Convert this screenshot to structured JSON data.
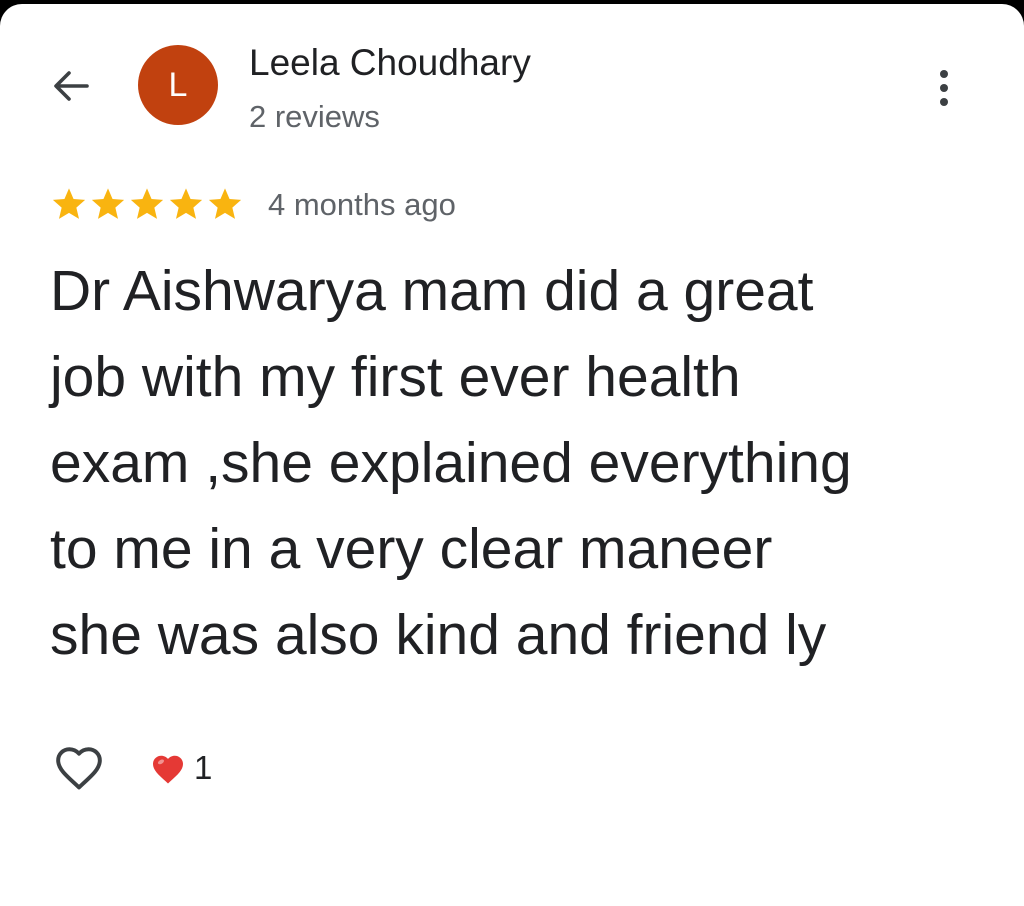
{
  "colors": {
    "avatar_bg": "#c1410f",
    "primary_text": "#202124",
    "secondary_text": "#5f6368",
    "star": "#f9b410",
    "heart_red": "#e53935",
    "icon": "#3c4043"
  },
  "header": {
    "back_icon": "arrow-left-icon",
    "avatar_letter": "L",
    "reviewer_name": "Leela Choudhary",
    "reviewer_subtitle": "2 reviews",
    "menu_icon": "more-vertical-icon"
  },
  "review": {
    "rating": 5,
    "rating_max": 5,
    "time_ago": "4 months ago",
    "text": "Dr Aishwarya mam did a great\njob with my first ever health\nexam ,she explained everything\nto me in a very clear maneer\nshe was also kind and friend ly"
  },
  "footer": {
    "like_icon": "heart-outline-icon",
    "reaction_icon": "red-heart-icon",
    "reaction_count": "1"
  }
}
